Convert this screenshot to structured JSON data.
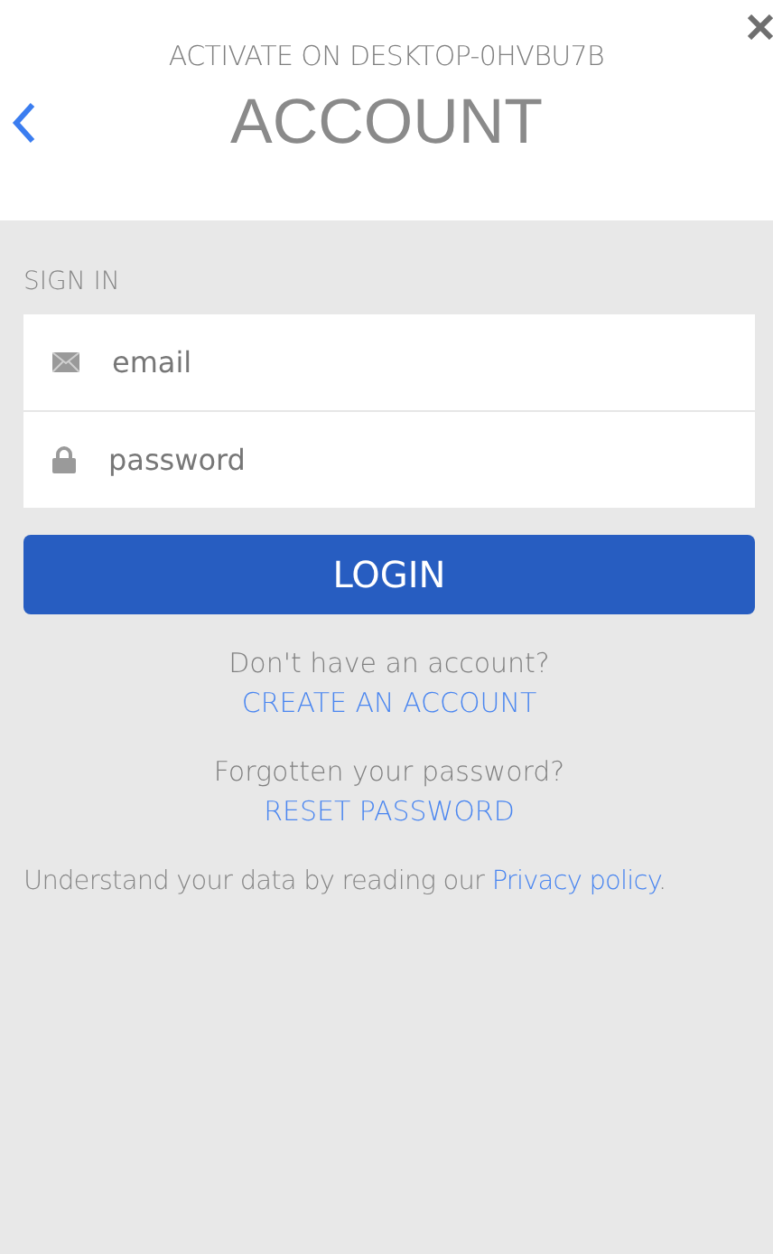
{
  "header": {
    "subtitle": "ACTIVATE ON DESKTOP-0HVBU7B",
    "title": "ACCOUNT"
  },
  "section_title": "SIGN IN",
  "fields": [
    {
      "kind": "email",
      "placeholder": "email"
    },
    {
      "kind": "password",
      "placeholder": "password"
    }
  ],
  "login_button": "LOGIN",
  "links": [
    {
      "prompt": "Don't have an account?",
      "link": "CREATE AN ACCOUNT"
    },
    {
      "prompt": "Forgotten your password?",
      "link": "RESET PASSWORD"
    }
  ],
  "privacy": {
    "text": "Understand your data by reading our ",
    "link": "Privacy policy",
    "after": "."
  }
}
